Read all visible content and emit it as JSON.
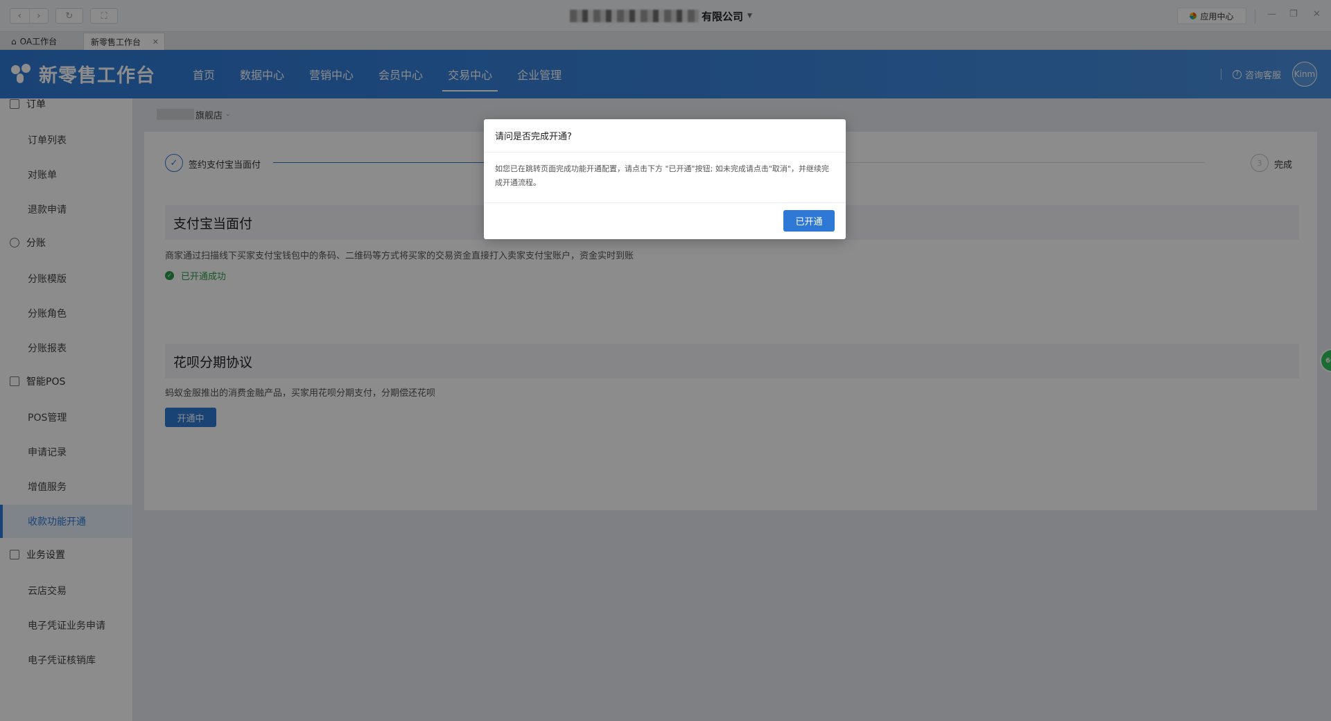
{
  "titlebar": {
    "company": "有限公司",
    "app_center": "应用中心"
  },
  "tabs": [
    {
      "label": "OA工作台"
    },
    {
      "label": "新零售工作台"
    }
  ],
  "header": {
    "logo": "新零售工作台",
    "nav": [
      "首页",
      "数据中心",
      "营销中心",
      "会员中心",
      "交易中心",
      "企业管理"
    ],
    "active_nav": "交易中心",
    "help": "咨询客服",
    "avatar": "Kinm"
  },
  "sidebar": {
    "groups": [
      {
        "label": "订单",
        "items": [
          "订单列表",
          "对账单",
          "退款申请"
        ]
      },
      {
        "label": "分账",
        "items": [
          "分账模版",
          "分账角色",
          "分账报表"
        ]
      },
      {
        "label": "智能POS",
        "items": [
          "POS管理",
          "申请记录",
          "增值服务",
          "收款功能开通"
        ]
      },
      {
        "label": "业务设置",
        "items": [
          "云店交易",
          "电子凭证业务申请",
          "电子凭证核销库"
        ]
      }
    ],
    "active_item": "收款功能开通"
  },
  "main": {
    "shop": "旗舰店",
    "steps": [
      {
        "label": "签约支付宝当面付",
        "state": "done"
      },
      {
        "label": "完成",
        "index": "3",
        "state": "pending"
      }
    ],
    "sections": [
      {
        "title": "支付宝当面付",
        "desc": "商家通过扫描线下买家支付宝钱包中的条码、二维码等方式将买家的交易资金直接打入卖家支付宝账户，资金实时到账",
        "status": "已开通成功"
      },
      {
        "title": "花呗分期协议",
        "desc": "蚂蚁金服推出的消费金融产品，买家用花呗分期支付，分期偿还花呗",
        "button": "开通中"
      }
    ],
    "float_ball": "60"
  },
  "modal": {
    "title": "请问是否完成开通?",
    "body": "如您已在跳转页面完成功能开通配置，请点击下方 \"已开通\"按钮; 如未完成请点击\"取消\"，并继续完成开通流程。",
    "ok": "已开通"
  },
  "colors": {
    "primary": "#2f79d6",
    "success": "#2a9d4b"
  }
}
